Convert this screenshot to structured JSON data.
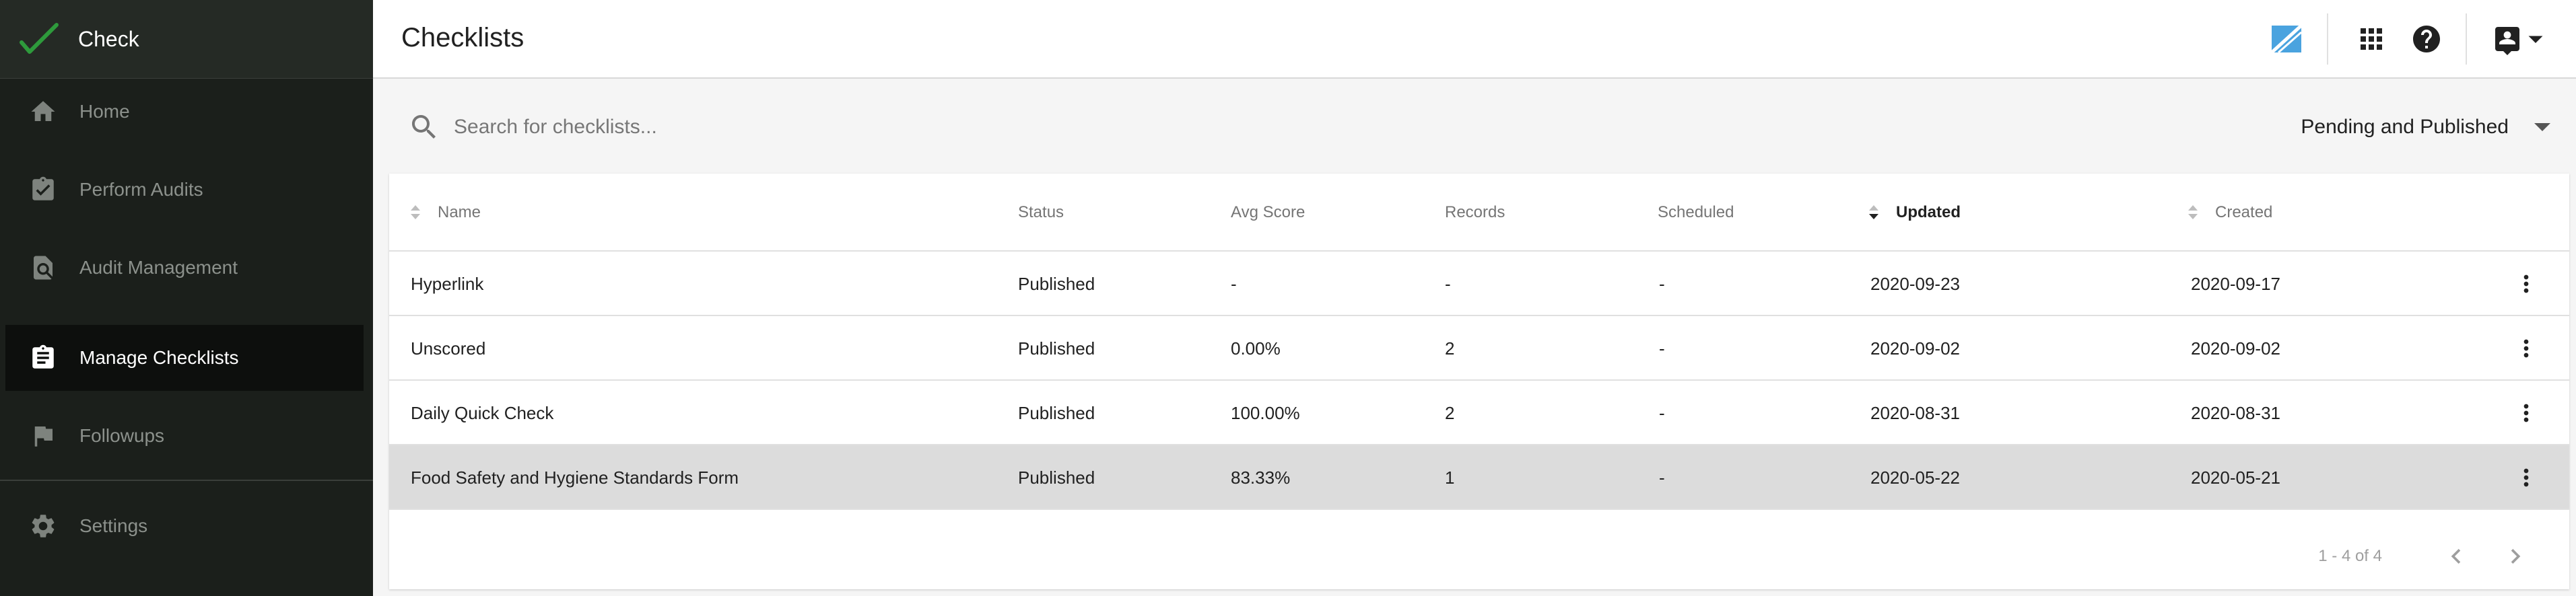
{
  "app": {
    "name": "Check",
    "accent": "#2e9a3c"
  },
  "sidebar": {
    "items": [
      {
        "label": "Home",
        "icon": "home-icon"
      },
      {
        "label": "Perform Audits",
        "icon": "clipboard-check-icon"
      },
      {
        "label": "Audit Management",
        "icon": "document-search-icon"
      },
      {
        "label": "Manage Checklists",
        "icon": "assignment-icon",
        "active": true
      },
      {
        "label": "Followups",
        "icon": "flag-icon"
      },
      {
        "label": "Settings",
        "icon": "gear-icon"
      }
    ]
  },
  "header": {
    "title": "Checklists",
    "icons": [
      "brand-logo-icon",
      "apps-grid-icon",
      "help-icon",
      "account-icon",
      "caret-down-icon"
    ]
  },
  "search": {
    "placeholder": "Search for checklists...",
    "value": "",
    "filter_value": "Pending and Published"
  },
  "table": {
    "columns": [
      "Name",
      "Status",
      "Avg Score",
      "Records",
      "Scheduled",
      "Updated",
      "Created"
    ],
    "sorted_column": "Updated",
    "rows": [
      {
        "name": "Hyperlink",
        "status": "Published",
        "avg_score": "-",
        "records": "-",
        "scheduled": "-",
        "updated": "2020-09-23",
        "created": "2020-09-17"
      },
      {
        "name": "Unscored",
        "status": "Published",
        "avg_score": "0.00%",
        "records": "2",
        "scheduled": "-",
        "updated": "2020-09-02",
        "created": "2020-09-02"
      },
      {
        "name": "Daily Quick Check",
        "status": "Published",
        "avg_score": "100.00%",
        "records": "2",
        "scheduled": "-",
        "updated": "2020-08-31",
        "created": "2020-08-31"
      },
      {
        "name": "Food Safety and Hygiene Standards Form",
        "status": "Published",
        "avg_score": "83.33%",
        "records": "1",
        "scheduled": "-",
        "updated": "2020-05-22",
        "created": "2020-05-21",
        "highlighted": true
      }
    ]
  },
  "pagination": {
    "text": "1 - 4 of 4"
  }
}
